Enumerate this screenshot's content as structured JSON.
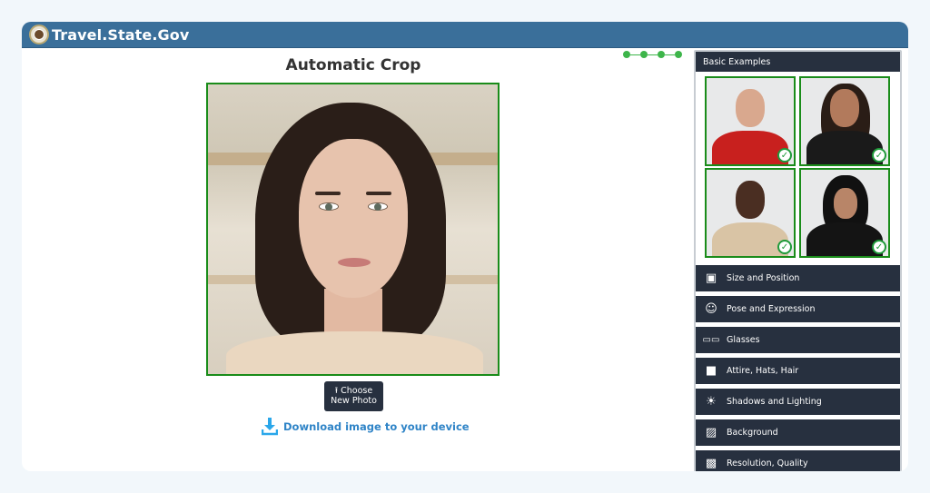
{
  "header": {
    "brand": "Travel.State.Gov",
    "seal_icon": "us-state-department-seal"
  },
  "main": {
    "title": "Automatic Crop",
    "photo_alt": "Cropped portrait of a woman with dark shoulder-length hair",
    "choose_button": {
      "icon": "upload-icon",
      "line1": "Choose",
      "line2": "New Photo"
    },
    "download_link": {
      "icon": "download-icon",
      "label": "Download image to your device"
    },
    "progress_steps": {
      "total": 4,
      "completed": 4
    }
  },
  "sidebar": {
    "header": "Basic Examples",
    "examples": [
      {
        "label": "Example man in red shirt",
        "status": "approved"
      },
      {
        "label": "Example woman with long hair",
        "status": "approved"
      },
      {
        "label": "Example man in beige shirt",
        "status": "approved"
      },
      {
        "label": "Example woman in black hijab",
        "status": "approved"
      }
    ],
    "menu": [
      {
        "label": "Size and Position",
        "icon": "portrait-frame-icon"
      },
      {
        "label": "Pose and Expression",
        "icon": "neutral-face-icon"
      },
      {
        "label": "Glasses",
        "icon": "glasses-icon"
      },
      {
        "label": "Attire, Hats, Hair",
        "icon": "top-hat-icon"
      },
      {
        "label": "Shadows and Lighting",
        "icon": "sun-icon"
      },
      {
        "label": "Background",
        "icon": "image-icon"
      },
      {
        "label": "Resolution, Quality",
        "icon": "pixelated-face-icon"
      }
    ]
  },
  "colors": {
    "header_bg": "#3a6f9a",
    "accent_green": "#1a8c1a",
    "link_blue": "#2f84c7",
    "dark_panel": "#27303f"
  }
}
